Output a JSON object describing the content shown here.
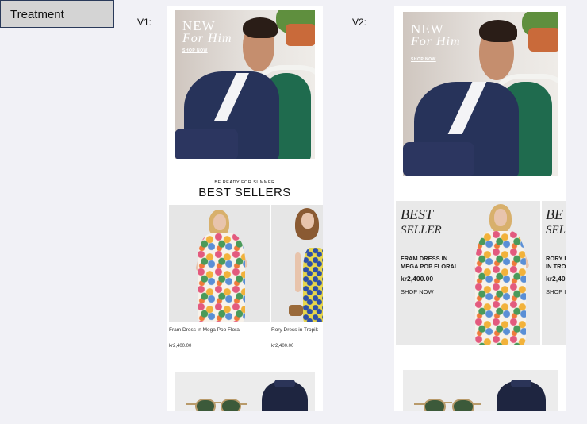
{
  "header": {
    "label": "Treatment"
  },
  "variants": {
    "v1": {
      "label": "V1:",
      "hero": {
        "line1": "NEW",
        "line2": "For Him",
        "cta": "SHOP NOW"
      },
      "section": {
        "eyebrow": "BE READY FOR SUMMER",
        "title": "BEST SELLERS"
      },
      "products": [
        {
          "name": "Fram Dress in Mega Pop Floral",
          "price": "kr2,400.00"
        },
        {
          "name": "Rory Dress in Tropik",
          "price": "kr2,400.00"
        }
      ]
    },
    "v2": {
      "label": "V2:",
      "hero": {
        "line1": "NEW",
        "line2": "For Him",
        "cta": "SHOP NOW"
      },
      "best_seller": {
        "title1": "BEST",
        "title2": "SELLER",
        "name": "FRAM DRESS IN MEGA POP FLORAL",
        "price": "kr2,400.00",
        "cta": "SHOP NOW",
        "peek_title1": "BE",
        "peek_title2": "SEL",
        "peek_name": "RORY I IN TRO",
        "peek_price": "kr2,40",
        "peek_cta": "SHOP I"
      }
    }
  },
  "colors": {
    "page_bg": "#f1f1f6",
    "jacket_navy": "#27335a",
    "chair_green": "#1f6b4e"
  }
}
